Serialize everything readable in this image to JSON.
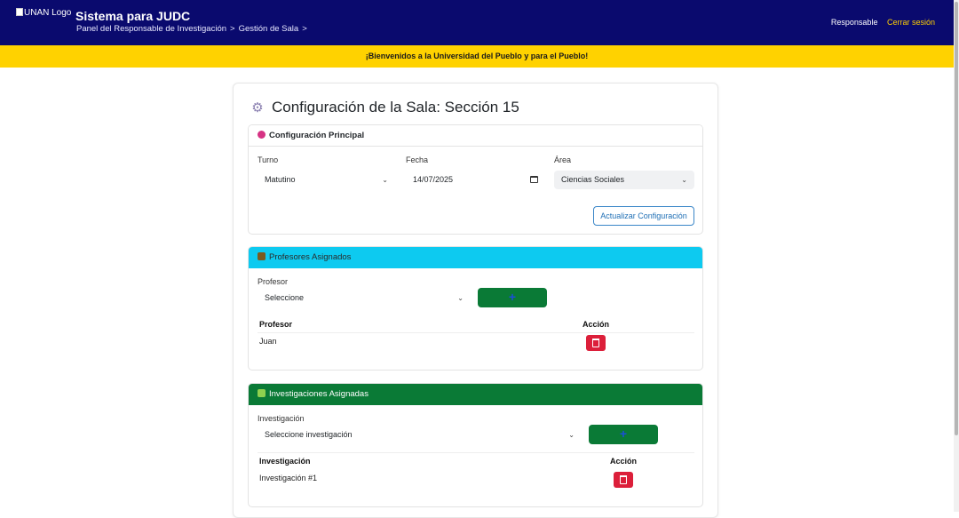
{
  "header": {
    "logo_alt": "UNAN Logo",
    "title": "Sistema para JUDC",
    "breadcrumb": [
      "Panel del Responsable de Investigación",
      ">",
      "Gestión de Sala",
      ">"
    ],
    "role": "Responsable",
    "logout": "Cerrar sesión"
  },
  "banner": "¡Bienvenidos a la Universidad del Pueblo y para el Pueblo!",
  "page": {
    "title": "Configuración de la Sala: Sección 15",
    "title_icon": "gear-icon"
  },
  "config": {
    "heading": "Configuración Principal",
    "turno_label": "Turno",
    "turno_value": "Matutino",
    "fecha_label": "Fecha",
    "fecha_value": "14/07/2025",
    "area_label": "Área",
    "area_value": "Ciencias Sociales",
    "update_button": "Actualizar Configuración"
  },
  "profesores": {
    "heading": "Profesores Asignados",
    "field_label": "Profesor",
    "select_value": "Seleccione",
    "add_button": "+",
    "columns": [
      "Profesor",
      "Acción"
    ],
    "rows": [
      {
        "name": "Juan"
      }
    ]
  },
  "investigaciones": {
    "heading": "Investigaciones Asignadas",
    "field_label": "Investigación",
    "select_value": "Seleccione investigación",
    "add_button": "+",
    "columns": [
      "Investigación",
      "Acción"
    ],
    "rows": [
      {
        "name": "Investigación #1"
      }
    ]
  },
  "colors": {
    "navbar": "#0a0a6e",
    "banner": "#ffd200",
    "info": "#0dcaf0",
    "success": "#0a7a36",
    "danger": "#dc1f3a"
  }
}
